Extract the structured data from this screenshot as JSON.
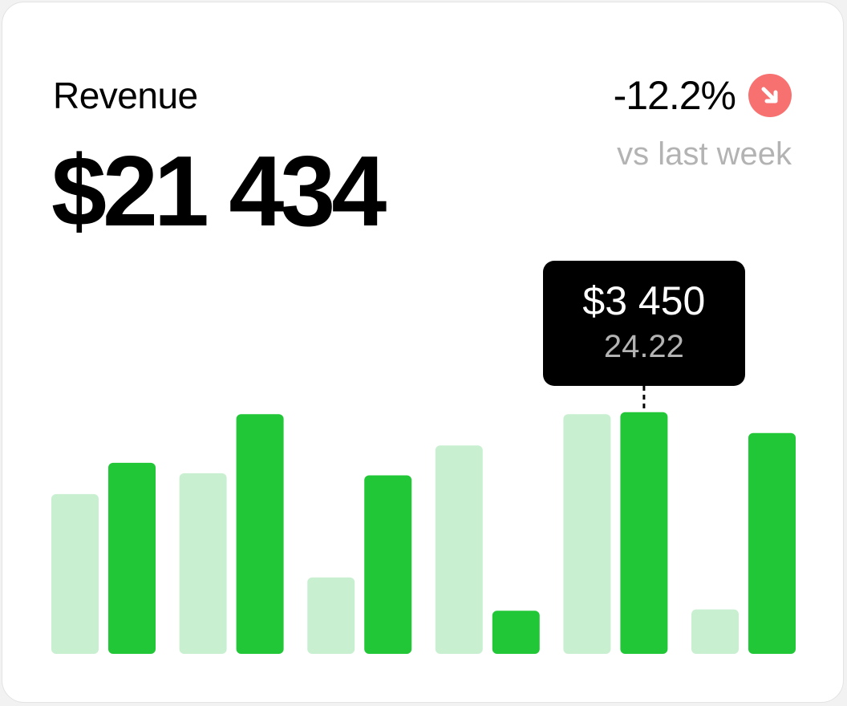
{
  "card": {
    "title": "Revenue",
    "amount": "$21 434",
    "change": "-12.2%",
    "change_icon": "arrow-down-right-icon",
    "compare_label": "vs last week"
  },
  "colors": {
    "accent": "#22c738",
    "accent_light": "#c8f0d0",
    "negative": "#f87171",
    "tooltip_bg": "#000000"
  },
  "chart_data": {
    "type": "bar",
    "series": [
      {
        "values": [
          2300,
          2600,
          1100,
          3000,
          3450,
          640
        ]
      },
      {
        "values": [
          2750,
          3450,
          2570,
          620,
          3480,
          3180
        ]
      }
    ],
    "ylim": [
      0,
      3500
    ],
    "grid": false,
    "tooltip": {
      "value": "$3 450",
      "sub": "24.22",
      "group": 4,
      "series": 1
    }
  }
}
